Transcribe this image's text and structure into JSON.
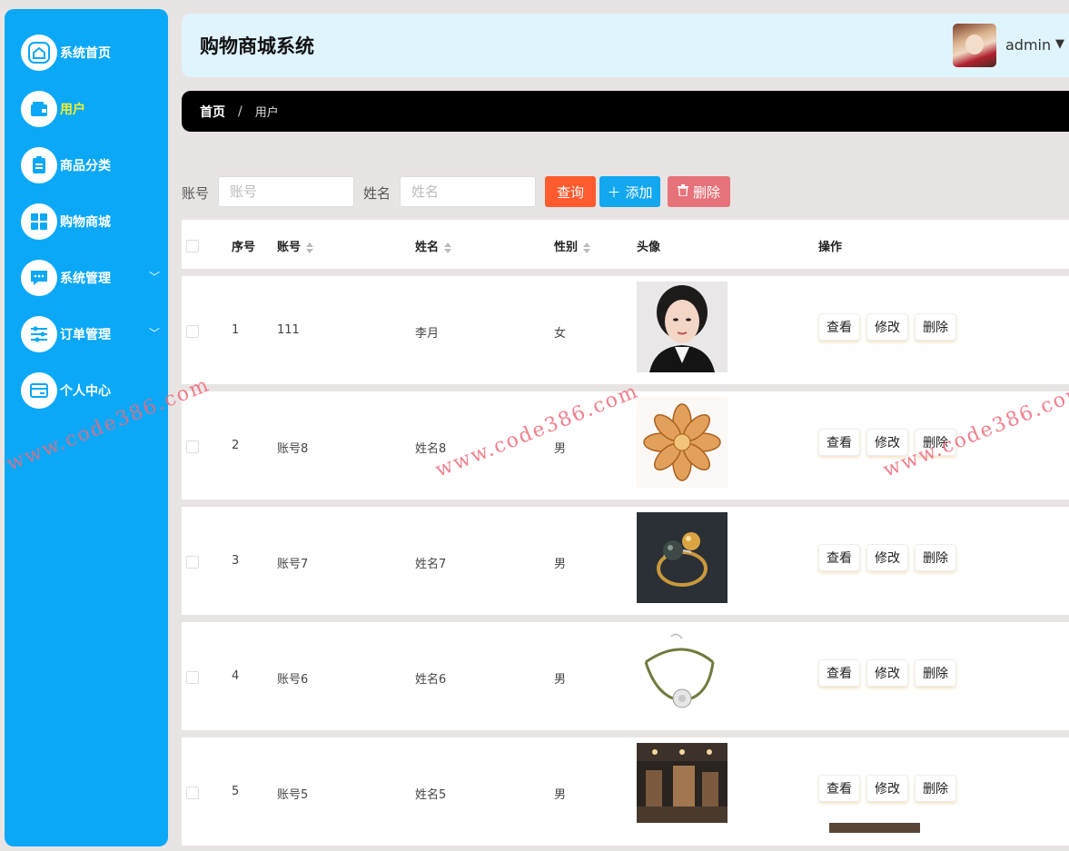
{
  "sidebar": {
    "items": [
      {
        "label": "系统首页",
        "icon": "home-icon",
        "active": false
      },
      {
        "label": "用户",
        "icon": "wallet-icon",
        "active": true
      },
      {
        "label": "商品分类",
        "icon": "clipboard-icon",
        "active": false
      },
      {
        "label": "购物商城",
        "icon": "grid-icon",
        "active": false
      },
      {
        "label": "系统管理",
        "icon": "chat-icon",
        "active": false,
        "expandable": true
      },
      {
        "label": "订单管理",
        "icon": "sliders-icon",
        "active": false,
        "expandable": true
      },
      {
        "label": "个人中心",
        "icon": "card-icon",
        "active": false
      }
    ]
  },
  "header": {
    "title": "购物商城系统",
    "username": "admin"
  },
  "breadcrumb": {
    "home": "首页",
    "separator": "/",
    "current": "用户"
  },
  "search": {
    "account_label": "账号",
    "account_placeholder": "账号",
    "name_label": "姓名",
    "name_placeholder": "姓名",
    "query_label": "查询",
    "add_label": "添加",
    "delete_label": "删除"
  },
  "table": {
    "headers": {
      "index": "序号",
      "account": "账号",
      "name": "姓名",
      "gender": "性别",
      "avatar": "头像",
      "actions": "操作"
    },
    "actions": {
      "view": "查看",
      "edit": "修改",
      "delete": "删除"
    },
    "rows": [
      {
        "index": "1",
        "account": "111",
        "name": "李月",
        "gender": "女",
        "image": "portrait-photo"
      },
      {
        "index": "2",
        "account": "账号8",
        "name": "姓名8",
        "gender": "男",
        "image": "golden-flower-jewelry"
      },
      {
        "index": "3",
        "account": "账号7",
        "name": "姓名7",
        "gender": "男",
        "image": "pearl-ring"
      },
      {
        "index": "4",
        "account": "账号6",
        "name": "姓名6",
        "gender": "男",
        "image": "silver-bracelet"
      },
      {
        "index": "5",
        "account": "账号5",
        "name": "姓名5",
        "gender": "男",
        "image": "store-interior"
      }
    ]
  },
  "watermark": "www.code386.com",
  "colors": {
    "sidebar": "#0aa8f7",
    "header_bg": "#e0f4fd",
    "query_button": "#ff5b2e",
    "add_button": "#12a7ef",
    "delete_button": "#e6727a",
    "active_menu_text": "#f6f02c"
  }
}
